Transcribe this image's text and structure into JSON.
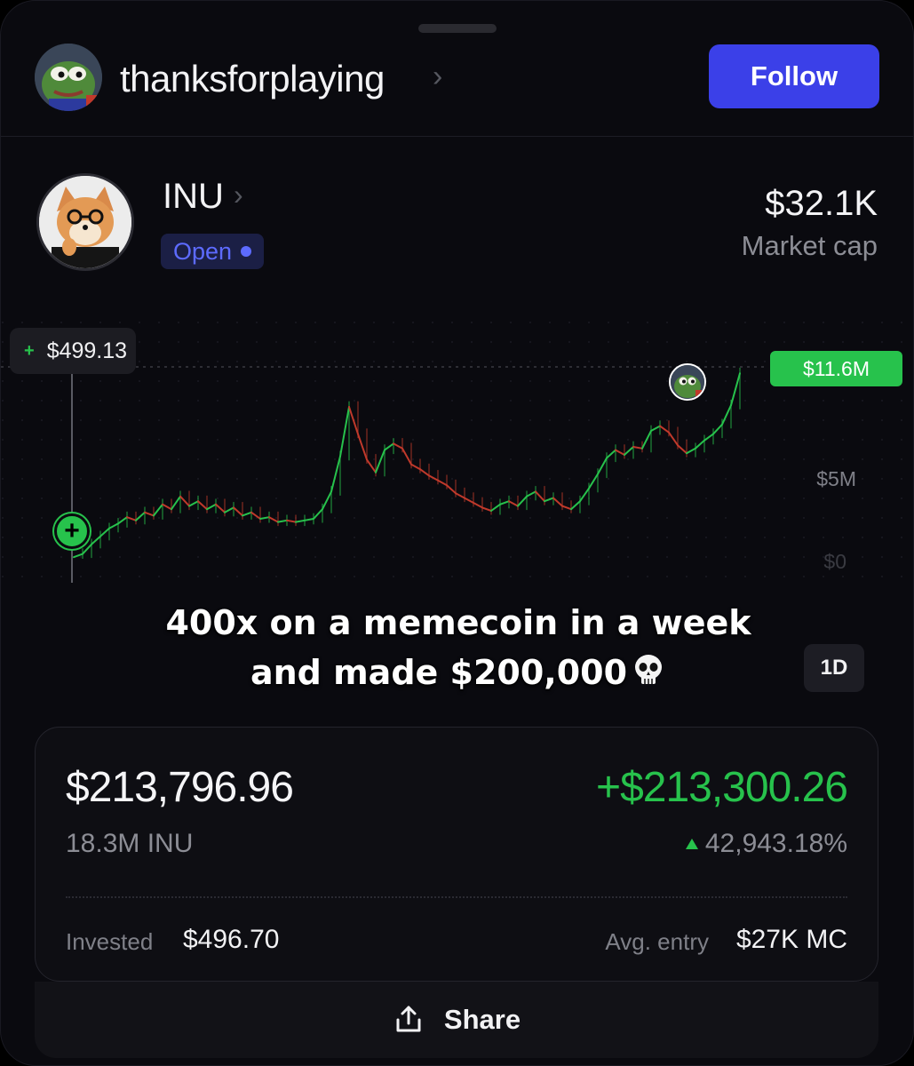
{
  "header": {
    "username": "thanksforplaying",
    "follow_label": "Follow"
  },
  "token": {
    "name": "INU",
    "status": "Open",
    "market_cap_value": "$32.1K",
    "market_cap_label": "Market cap"
  },
  "chart": {
    "entry_value": "$499.13",
    "current_price_tag": "$11.6M",
    "y_labels": [
      "$5M",
      "$0"
    ],
    "range": "1D",
    "colors": {
      "up": "#27c24c",
      "down": "#c0392b",
      "accent": "#3b40e8"
    }
  },
  "chart_data": {
    "type": "line",
    "x": [
      0,
      1,
      2,
      3,
      4,
      5,
      6,
      7,
      8,
      9,
      10,
      11,
      12,
      13,
      14,
      15,
      16,
      17,
      18,
      19,
      20,
      21,
      22,
      23,
      24,
      25,
      26,
      27,
      28,
      29,
      30,
      31,
      32,
      33,
      34,
      35,
      36,
      37,
      38,
      39,
      40,
      41,
      42,
      43,
      44,
      45,
      46,
      47,
      48,
      49,
      50,
      51,
      52,
      53,
      54,
      55,
      56,
      57,
      58,
      59,
      60,
      61,
      62,
      63,
      64,
      65,
      66,
      67,
      68,
      69,
      70,
      71,
      72,
      73,
      74,
      75
    ],
    "values": [
      0.1,
      0.3,
      0.9,
      1.4,
      1.9,
      2.2,
      2.6,
      2.4,
      2.9,
      2.7,
      3.4,
      3.1,
      3.9,
      3.3,
      3.6,
      3.1,
      3.4,
      2.9,
      3.2,
      2.7,
      2.9,
      2.5,
      2.6,
      2.3,
      2.4,
      2.3,
      2.4,
      2.5,
      3.1,
      4.2,
      6.4,
      9.5,
      7.8,
      6.2,
      5.4,
      6.8,
      7.2,
      6.9,
      5.9,
      5.6,
      5.2,
      4.9,
      4.6,
      4.1,
      3.8,
      3.5,
      3.2,
      3.0,
      3.4,
      3.6,
      3.3,
      3.9,
      4.2,
      3.6,
      3.8,
      3.3,
      3.1,
      3.6,
      4.4,
      5.3,
      6.3,
      6.8,
      6.5,
      7.0,
      6.9,
      8.0,
      8.3,
      7.9,
      7.1,
      6.6,
      6.9,
      7.4,
      7.8,
      8.4,
      9.6,
      11.6
    ],
    "ylabel": "",
    "ylim": [
      0,
      12
    ]
  },
  "caption": {
    "line1": "400x on a memecoin in a week",
    "line2": "and made $200,000"
  },
  "position": {
    "value": "$213,796.96",
    "gain": "+$213,300.26",
    "quantity": "18.3M INU",
    "gain_pct": "42,943.18%",
    "invested_label": "Invested",
    "invested_value": "$496.70",
    "avg_entry_label": "Avg. entry",
    "avg_entry_value": "$27K MC"
  },
  "share": {
    "label": "Share"
  },
  "icons": [
    "frog-avatar-icon",
    "chevron-right-icon",
    "doge-token-icon",
    "status-dot-icon",
    "plus-icon",
    "skull-icon",
    "arrow-up-icon",
    "share-icon"
  ]
}
